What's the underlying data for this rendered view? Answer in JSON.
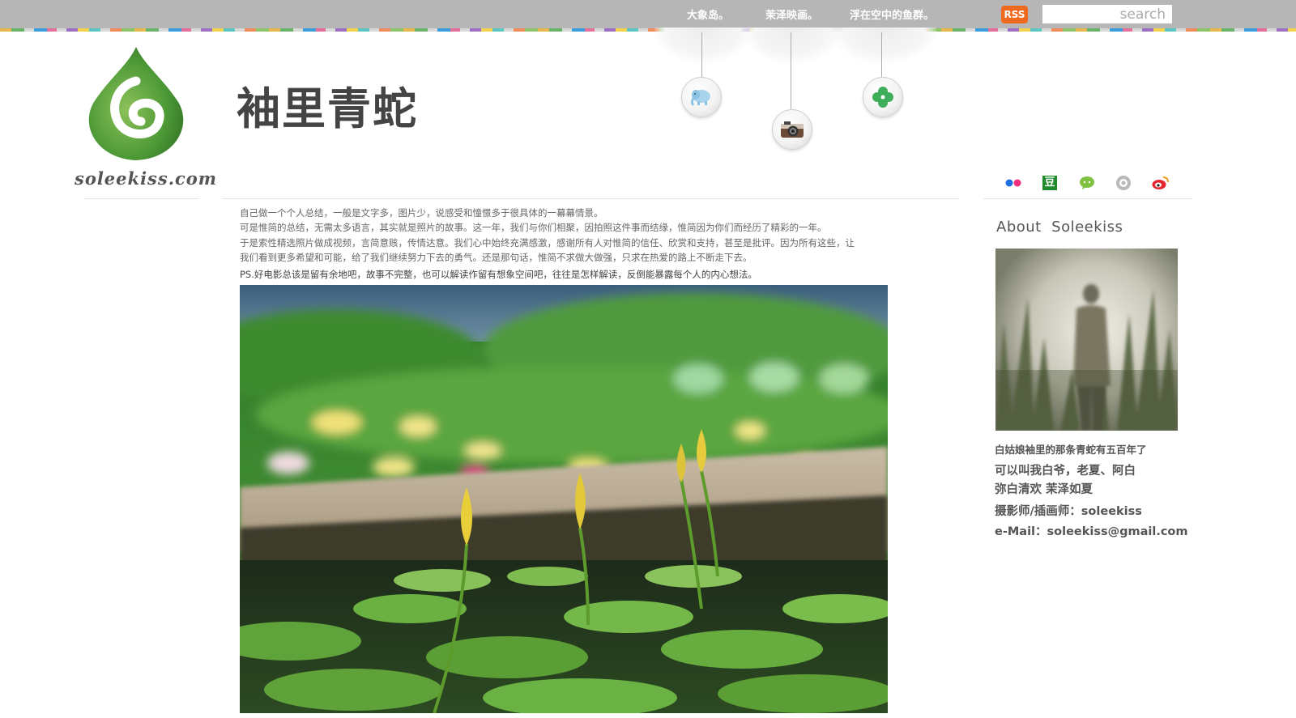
{
  "topbar": {
    "nav": [
      "大象岛。",
      "茉泽映画。",
      "浮在空中的鱼群。"
    ],
    "rss_label": "RSS",
    "search_placeholder": "search"
  },
  "header": {
    "logo_text": "soleekiss.com",
    "site_title": "袖里青蛇",
    "ornaments": [
      "elephant-icon",
      "camera-icon",
      "clover-icon"
    ],
    "social_icons": [
      "flickr-icon",
      "douban-icon",
      "chat-icon",
      "record-icon",
      "weibo-icon"
    ],
    "douban_glyph": "豆"
  },
  "article": {
    "lines": [
      "自己做一个个人总结，一般是文字多，图片少，说感受和憧憬多于很具体的一幕幕情景。",
      "可是惟简的总结，无需太多语言，其实就是照片的故事。这一年，我们与你们相聚，因拍照这件事而结缘，惟简因为你们而经历了精彩的一年。",
      "于是索性精选照片做成视频，言简意赅，传情达意。我们心中始终充满感激，感谢所有人对惟简的信任、欣赏和支持，甚至是批评。因为所有这些，让",
      "我们看到更多希望和可能，给了我们继续努力下去的勇气。还是那句话，惟简不求做大做强，只求在热爱的路上不断走下去。"
    ],
    "ps": "PS.好电影总该是留有余地吧，故事不完整，也可以解读作留有想象空间吧，往往是怎样解读，反倒能暴露每个人的内心想法。"
  },
  "sidebar": {
    "about_title": "About  Soleekiss",
    "line1": "白姑娘袖里的那条青蛇有五百年了",
    "line2": "可以叫我白爷，老夏、阿白",
    "line3": "弥白清欢 茉泽如夏",
    "line4": "摄影师/插画师：soleekiss",
    "line5": "e-Mail：soleekiss@gmail.com"
  }
}
